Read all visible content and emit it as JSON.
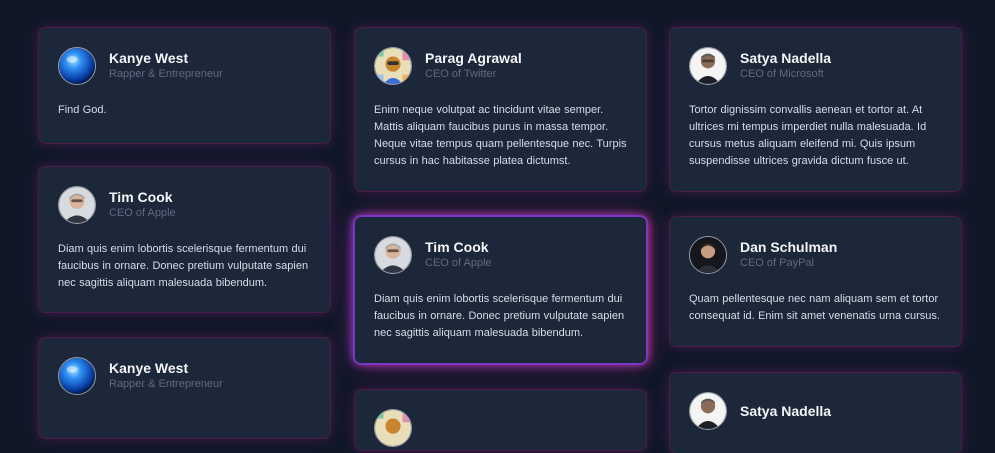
{
  "columns": [
    [
      {
        "name": "Kanye West",
        "role": "Rapper & Entrepreneur",
        "quote": "Find God.",
        "avatar_icon": "blue-orb-avatar"
      },
      {
        "name": "Tim Cook",
        "role": "CEO of Apple",
        "quote": "Diam quis enim lobortis scelerisque fermentum dui faucibus in ornare. Donec pretium vulputate sapien nec sagittis aliquam malesuada bibendum.",
        "avatar_icon": "tim-cook-avatar"
      },
      {
        "name": "Kanye West",
        "role": "Rapper & Entrepreneur",
        "quote": "",
        "avatar_icon": "blue-orb-avatar"
      }
    ],
    [
      {
        "name": "Parag Agrawal",
        "role": "CEO of Twitter",
        "quote": "Enim neque volutpat ac tincidunt vitae semper. Mattis aliquam faucibus purus in massa tempor. Neque vitae tempus quam pellentesque nec. Turpis cursus in hac habitasse platea dictumst.",
        "avatar_icon": "parag-agrawal-avatar"
      },
      {
        "name": "Tim Cook",
        "role": "CEO of Apple",
        "quote": "Diam quis enim lobortis scelerisque fermentum dui faucibus in ornare. Donec pretium vulputate sapien nec sagittis aliquam malesuada bibendum.",
        "avatar_icon": "tim-cook-avatar"
      },
      {
        "name": "",
        "role": "",
        "quote": "",
        "avatar_icon": "parag-agrawal-avatar"
      }
    ],
    [
      {
        "name": "Satya Nadella",
        "role": "CEO of Microsoft",
        "quote": "Tortor dignissim convallis aenean et tortor at. At ultrices mi tempus imperdiet nulla malesuada. Id cursus metus aliquam eleifend mi. Quis ipsum suspendisse ultrices gravida dictum fusce ut.",
        "avatar_icon": "satya-nadella-avatar"
      },
      {
        "name": "Dan Schulman",
        "role": "CEO of PayPal",
        "quote": "Quam pellentesque nec nam aliquam sem et tortor consequat id. Enim sit amet venenatis urna cursus.",
        "avatar_icon": "dan-schulman-avatar"
      },
      {
        "name": "Satya Nadella",
        "role": "",
        "quote": "",
        "avatar_icon": "satya-nadella-avatar"
      }
    ]
  ],
  "active_card": "Tim Cook",
  "colors": {
    "background": "#101827",
    "card": "#1d273a",
    "glow_pink": "#e0328c",
    "glow_violet": "#8c3ce6",
    "name": "#f3f5f9",
    "role": "#5e6a80",
    "quote": "#d8dde6"
  }
}
